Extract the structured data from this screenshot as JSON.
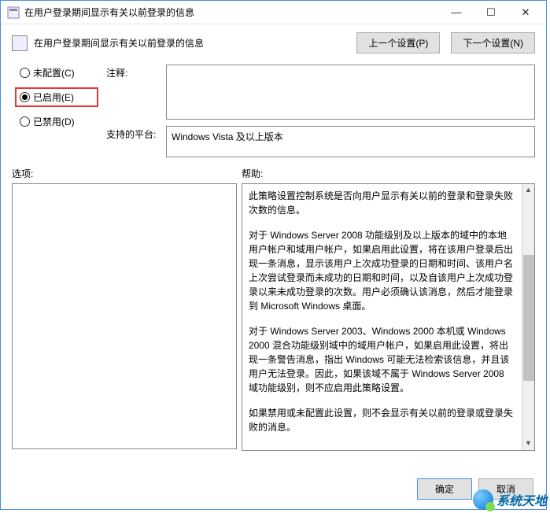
{
  "titlebar": {
    "title": "在用户登录期间显示有关以前登录的信息"
  },
  "header": {
    "policy_title": "在用户登录期间显示有关以前登录的信息",
    "prev_setting": "上一个设置(P)",
    "next_setting": "下一个设置(N)"
  },
  "radios": {
    "not_configured": "未配置(C)",
    "enabled": "已启用(E)",
    "disabled": "已禁用(D)"
  },
  "fields": {
    "comment_label": "注释:",
    "comment_value": "",
    "platform_label": "支持的平台:",
    "platform_value": "Windows Vista 及以上版本"
  },
  "lower": {
    "options_label": "选项:",
    "help_label": "帮助:"
  },
  "help_text": {
    "p1": "此策略设置控制系统是否向用户显示有关以前的登录和登录失败次数的信息。",
    "p2": "对于 Windows Server 2008 功能级别及以上版本的域中的本地用户帐户和域用户帐户，如果启用此设置，将在该用户登录后出现一条消息，显示该用户上次成功登录的日期和时间、该用户名上次尝试登录而未成功的日期和时间，以及自该用户上次成功登录以来未成功登录的次数。用户必须确认该消息，然后才能登录到 Microsoft Windows 桌面。",
    "p3": "对于 Windows Server 2003、Windows 2000 本机或 Windows 2000 混合功能级别域中的域用户帐户，如果启用此设置，将出现一条警告消息，指出 Windows 可能无法检索该信息，并且该用户无法登录。因此，如果该域不属于 Windows Server 2008 域功能级别，则不应启用此策略设置。",
    "p4": "如果禁用或未配置此设置，则不会显示有关以前的登录或登录失败的消息。"
  },
  "footer": {
    "ok": "确定",
    "cancel": "取消"
  },
  "watermark": {
    "text": "系统天地"
  }
}
